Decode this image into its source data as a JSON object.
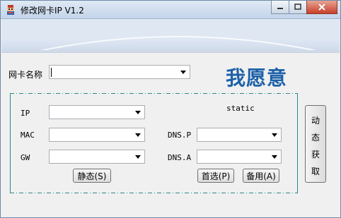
{
  "window": {
    "title": "修改网卡IP V1.2",
    "controls": {
      "minimize": "minimize",
      "maximize": "maximize",
      "close": "close"
    }
  },
  "header": {
    "brand_text": "我愿意"
  },
  "adapter": {
    "label": "网卡名称",
    "value": ""
  },
  "group": {
    "static_label": "static",
    "ip_label": "IP",
    "mac_label": "MAC",
    "gw_label": "GW",
    "dns_p_label": "DNS.P",
    "dns_a_label": "DNS.A",
    "ip_value": "",
    "mac_value": "",
    "gw_value": "",
    "dns_p_value": "",
    "dns_a_value": "",
    "static_button": "静态(S)",
    "preferred_button": "首选(P)",
    "alternate_button": "备用(A)"
  },
  "dynamic_button": {
    "chars": [
      "动",
      "态",
      "获",
      "取"
    ]
  },
  "colors": {
    "accent": "#1d61a8",
    "group_border": "#2a8a86"
  }
}
